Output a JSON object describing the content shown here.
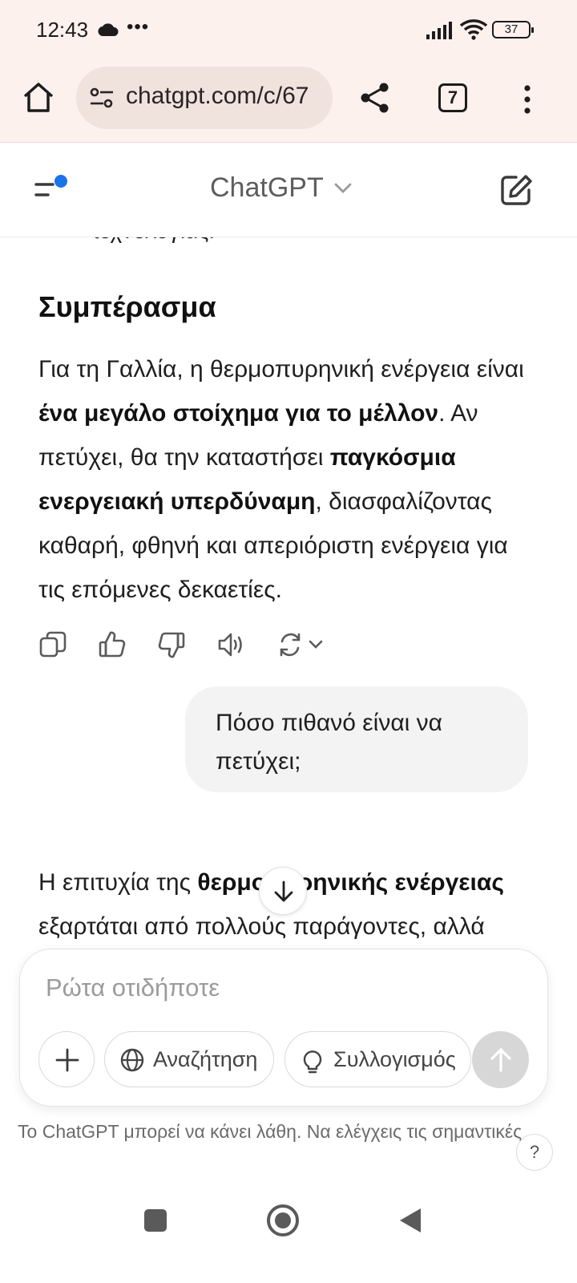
{
  "status_bar": {
    "time": "12:43",
    "dots": "•••",
    "battery": "37"
  },
  "browser": {
    "url": "chatgpt.com/c/67",
    "tab_count": "7"
  },
  "header": {
    "title": "ChatGPT"
  },
  "chat": {
    "cut_text": "τεχνολογίας.",
    "heading": "Συμπέρασμα",
    "answer": {
      "p1": "Για τη Γαλλία, η θερμοπυρηνική ενέργεια είναι ",
      "b1": "ένα μεγάλο στοίχημα για το μέλλον",
      "p2": ". Αν πετύχει, θα την καταστήσει ",
      "b2": "παγκόσμια ενεργειακή υπερδύναμη",
      "p3": ", διασφαλίζοντας καθαρή, φθηνή και απεριόριστη ενέργεια για τις επόμενες δεκαετίες."
    },
    "user_message": "Πόσο πιθανό είναι να πετύχει;",
    "answer2": {
      "p1": "Η επιτυχία της ",
      "b1": "θερμοπυρηνικής ενέργειας",
      "p2": " εξαρτάται από πολλούς παράγοντες, αλλά"
    }
  },
  "composer": {
    "placeholder": "Ρώτα οτιδήποτε",
    "search_label": "Αναζήτηση",
    "reason_label": "Συλλογισμός"
  },
  "disclaimer": "Το ChatGPT μπορεί να κάνει λάθη. Να ελέγχεις τις σημαντικές",
  "help_label": "?",
  "icons": {
    "status": [
      "cloud-icon",
      "signal-icon",
      "wifi-icon",
      "battery-icon"
    ],
    "browser": [
      "home-icon",
      "tune-icon",
      "share-icon",
      "tabs-icon",
      "more-vert-icon"
    ],
    "header": [
      "sidebar-icon",
      "chevron-down-icon",
      "edit-icon"
    ],
    "actions": [
      "copy-icon",
      "thumbs-up-icon",
      "thumbs-down-icon",
      "speaker-icon",
      "regenerate-icon"
    ],
    "composer": [
      "plus-icon",
      "globe-icon",
      "lightbulb-icon",
      "arrow-up-icon"
    ],
    "nav": [
      "recents-icon",
      "home-icon",
      "back-icon"
    ]
  },
  "colors": {
    "browser_bg": "#fdf1ee",
    "urlbar_bg": "#f0e2dd",
    "accent_dot": "#1a73e8",
    "user_bubble": "#f3f3f3",
    "send_disabled": "#d7d7d7"
  }
}
